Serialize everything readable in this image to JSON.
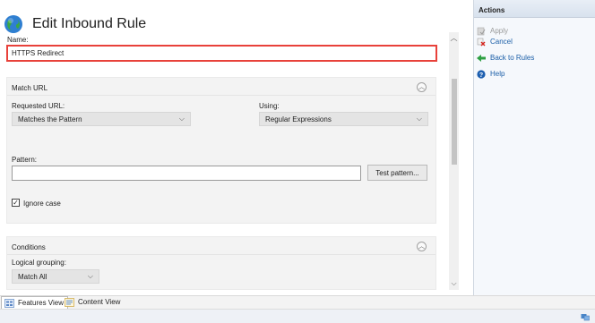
{
  "page": {
    "title": "Edit Inbound Rule",
    "name_label": "Name:",
    "name_value": "HTTPS Redirect"
  },
  "match_url": {
    "title": "Match URL",
    "requested_url_label": "Requested URL:",
    "requested_url_value": "Matches the Pattern",
    "using_label": "Using:",
    "using_value": "Regular Expressions",
    "pattern_label": "Pattern:",
    "pattern_value": "",
    "test_pattern_button": "Test pattern...",
    "ignore_case_label": "Ignore case",
    "ignore_case_checked": true
  },
  "conditions": {
    "title": "Conditions",
    "logical_grouping_label": "Logical grouping:",
    "logical_grouping_value": "Match All"
  },
  "actions_pane": {
    "title": "Actions",
    "items": [
      {
        "label": "Apply",
        "icon": "apply-icon",
        "enabled": false
      },
      {
        "label": "Cancel",
        "icon": "cancel-icon",
        "enabled": true
      },
      {
        "label": "Back to Rules",
        "icon": "back-arrow-icon",
        "enabled": true
      },
      {
        "label": "Help",
        "icon": "help-icon",
        "enabled": true
      }
    ]
  },
  "bottom_tabs": {
    "features_view": "Features View",
    "content_view": "Content View"
  },
  "colors": {
    "highlight_border": "#e8413a",
    "link": "#1c5fa8",
    "disabled": "#9a9a9a"
  }
}
